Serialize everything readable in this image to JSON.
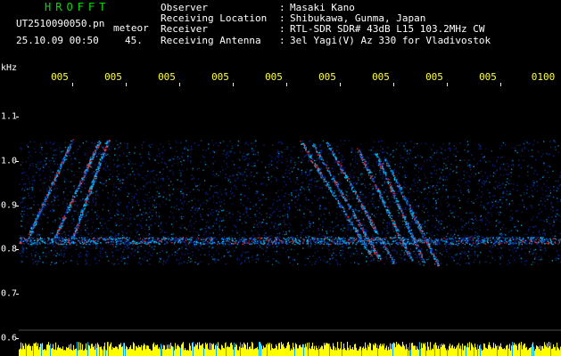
{
  "app": {
    "title": "HROFFT",
    "file_name": "UT2510090050.pn",
    "file_kind": "meteor",
    "timestamp": "25.10.09 00:50",
    "threshold": "45."
  },
  "station": [
    {
      "label": "Observer",
      "sep": ":",
      "value": "Masaki Kano"
    },
    {
      "label": "Receiving Location",
      "sep": ":",
      "value": "Shibukawa, Gunma, Japan"
    },
    {
      "label": "Receiver",
      "sep": ":",
      "value": "RTL-SDR SDR# 43dB L15 103.2MHz CW"
    },
    {
      "label": "Receiving Antenna",
      "sep": ":",
      "value": "3el Yagi(V) Az 330 for Vladivostok"
    }
  ],
  "axis": {
    "unit": "kHz",
    "time_ticks": [
      "005",
      "005",
      "005",
      "005",
      "005",
      "005",
      "005",
      "005",
      "005",
      "0100"
    ],
    "freq_ticks": [
      "1.1",
      "1.0",
      "0.9",
      "0.8",
      "0.7",
      "0.6"
    ]
  },
  "colors": {
    "title": "#00e000",
    "time_tick": "#ffff40",
    "noise_low": "#1030c0",
    "noise_mid": "#00c0ff",
    "signal_high": "#ff2020",
    "level_bar": "#ffff00",
    "level_bar_low": "#00b0ff"
  }
}
